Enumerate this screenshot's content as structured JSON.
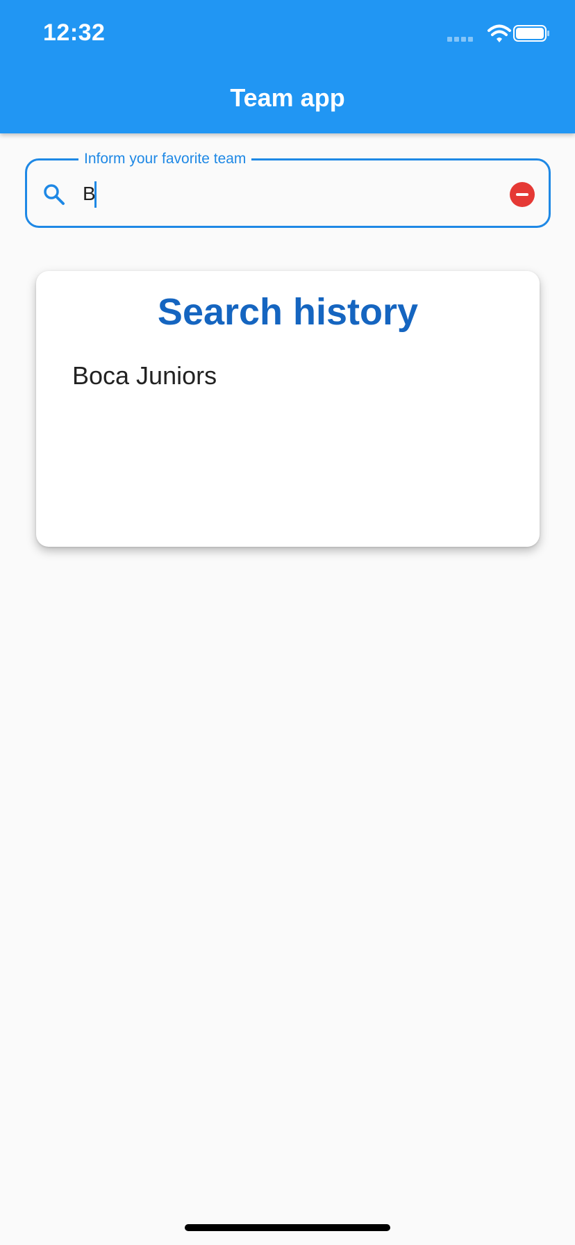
{
  "status_bar": {
    "time": "12:32",
    "icons": [
      "signal-icon",
      "wifi-icon",
      "battery-icon"
    ]
  },
  "app_bar": {
    "title": "Team app",
    "background_color": "#2196f3"
  },
  "search_field": {
    "label": "Inform your favorite team",
    "value": "B",
    "accent_color": "#1e88e5",
    "clear_button_color": "#e53935"
  },
  "history_card": {
    "title": "Search history",
    "title_color": "#1565c0",
    "items": [
      "Boca Juniors"
    ]
  }
}
